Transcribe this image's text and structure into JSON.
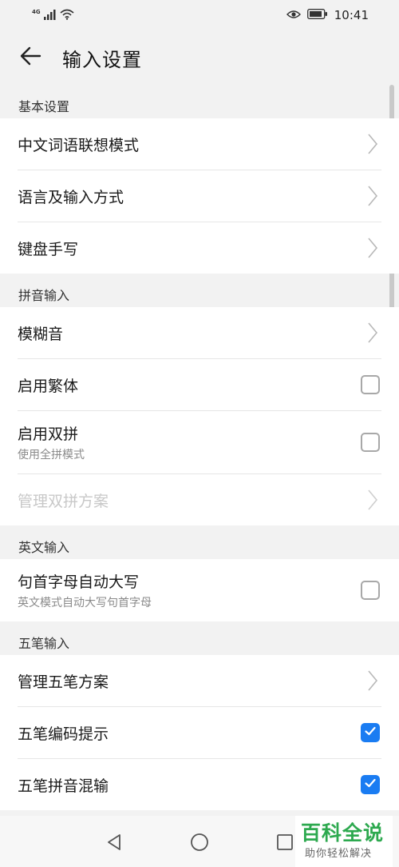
{
  "status_bar": {
    "network": "4G",
    "time": "10:41",
    "icons": [
      "signal-icon",
      "wifi-icon",
      "eye-comfort-icon",
      "battery-icon"
    ]
  },
  "header": {
    "title": "输入设置",
    "back_icon": "arrow-left-icon"
  },
  "sections": {
    "basic": {
      "title": "基本设置",
      "items": [
        {
          "label": "中文词语联想模式",
          "control": "chevron"
        },
        {
          "label": "语言及输入方式",
          "control": "chevron"
        },
        {
          "label": "键盘手写",
          "control": "chevron"
        }
      ]
    },
    "pinyin": {
      "title": "拼音输入",
      "items": [
        {
          "label": "模糊音",
          "control": "chevron"
        },
        {
          "label": "启用繁体",
          "control": "checkbox",
          "checked": false
        },
        {
          "label": "启用双拼",
          "sublabel": "使用全拼模式",
          "control": "checkbox",
          "checked": false
        },
        {
          "label": "管理双拼方案",
          "control": "chevron",
          "disabled": true
        }
      ]
    },
    "english": {
      "title": "英文输入",
      "items": [
        {
          "label": "句首字母自动大写",
          "sublabel": "英文模式自动大写句首字母",
          "control": "checkbox",
          "checked": false
        }
      ]
    },
    "wubi": {
      "title": "五笔输入",
      "items": [
        {
          "label": "管理五笔方案",
          "control": "chevron"
        },
        {
          "label": "五笔编码提示",
          "control": "checkbox",
          "checked": true
        },
        {
          "label": "五笔拼音混输",
          "control": "checkbox",
          "checked": true
        }
      ]
    }
  },
  "nav_bar": {
    "icons": [
      "back-triangle-icon",
      "home-circle-icon",
      "recents-square-icon"
    ]
  },
  "watermark": {
    "title": "百科全说",
    "subtitle": "助你轻松解决"
  },
  "colors": {
    "background": "#f2f2f2",
    "surface": "#ffffff",
    "accent": "#1a7cf2",
    "watermark_green": "#2da94f",
    "disabled_text": "#c8c8c8"
  }
}
